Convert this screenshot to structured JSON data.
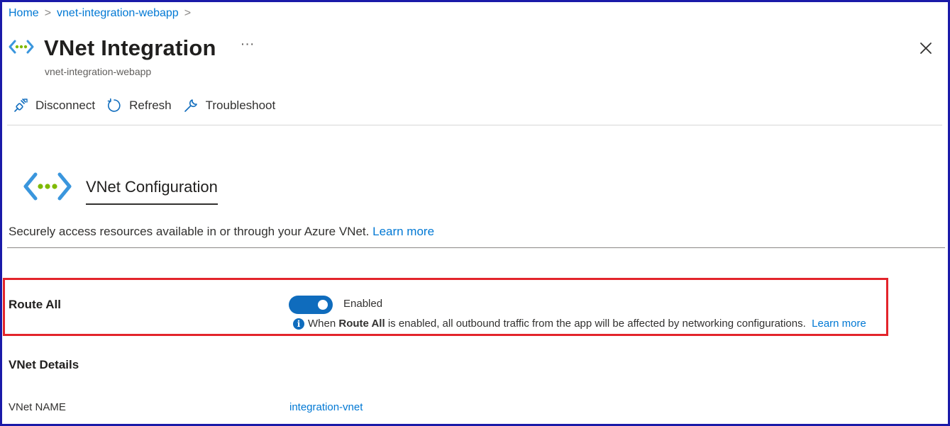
{
  "breadcrumb": {
    "items": [
      "Home",
      "vnet-integration-webapp"
    ],
    "separator": ">"
  },
  "header": {
    "title": "VNet Integration",
    "subtitle": "vnet-integration-webapp",
    "more": "···",
    "icon": "vnet-icon"
  },
  "toolbar": {
    "disconnect_label": "Disconnect",
    "refresh_label": "Refresh",
    "troubleshoot_label": "Troubleshoot"
  },
  "section": {
    "title": "VNet Configuration",
    "description": "Securely access resources available in or through your Azure VNet.",
    "learn_more": "Learn more"
  },
  "route_all": {
    "label": "Route All",
    "toggle_state": "Enabled",
    "enabled": true,
    "info_prefix": "When",
    "info_bold": "Route All",
    "info_suffix": "is enabled, all outbound traffic from the app will be affected by networking configurations.",
    "learn_more": "Learn more"
  },
  "vnet_details": {
    "title": "VNet Details",
    "name_label": "VNet NAME",
    "name_value": "integration-vnet"
  },
  "colors": {
    "accent": "#0078d4",
    "toggle": "#0f6cbd",
    "highlight_border": "#e3242b",
    "frame_border": "#1a1aa8"
  }
}
